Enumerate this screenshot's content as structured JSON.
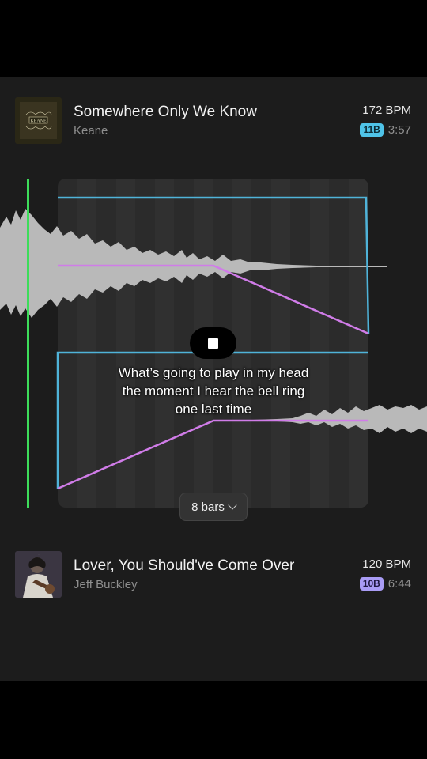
{
  "track_top": {
    "title": "Somewhere Only We Know",
    "artist": "Keane",
    "bpm": "172 BPM",
    "key": "11B",
    "duration": "3:57",
    "cover_text": "KEANE",
    "key_color": "#4fc3e8"
  },
  "transition": {
    "caption": "What’s going to play in my head the moment I hear the bell ring one last time",
    "length_label": "8 bars",
    "playhead_color": "#3ddc5a",
    "volume_color": "#4fb3d9",
    "eq_color": "#d07ce8",
    "stop_icon": "stop-icon"
  },
  "track_bottom": {
    "title": "Lover, You Should've Come Over",
    "artist": "Jeff Buckley",
    "bpm": "120 BPM",
    "key": "10B",
    "duration": "6:44",
    "key_color": "#a99cf5"
  }
}
